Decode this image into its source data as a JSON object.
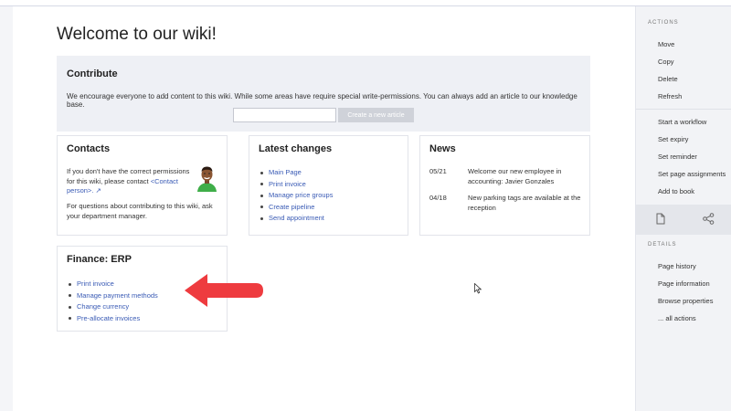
{
  "page": {
    "title": "Welcome to our wiki!"
  },
  "contribute": {
    "heading": "Contribute",
    "text": "We encourage everyone to add content to this wiki. While some areas have require special write-permissions. You can always add an article to our knowledge base.",
    "input_value": "",
    "button_label": "Create a new article"
  },
  "contacts": {
    "heading": "Contacts",
    "text1": "If you don't have the correct permissions for this wiki, please contact",
    "link": "<Contact person>.",
    "text2": "For questions about contributing to this wiki, ask your department manager."
  },
  "latest": {
    "heading": "Latest changes",
    "items": [
      "Main Page",
      "Print invoice",
      "Manage price groups",
      "Create pipeline",
      "Send appointment"
    ]
  },
  "news": {
    "heading": "News",
    "items": [
      {
        "date": "05/21",
        "text": "Welcome our new employee in accounting: Javier Gonzales"
      },
      {
        "date": "04/18",
        "text": "New parking tags are available at the reception"
      }
    ]
  },
  "finance": {
    "heading": "Finance: ERP",
    "items": [
      "Print invoice",
      "Manage payment methods",
      "Change currency",
      "Pre-allocate invoices"
    ]
  },
  "sidebar": {
    "actions_heading": "ACTIONS",
    "actions": [
      "Move",
      "Copy",
      "Delete",
      "Refresh"
    ],
    "workflow": [
      "Start a workflow",
      "Set expiry",
      "Set reminder",
      "Set page assignments",
      "Add to book"
    ],
    "icons": [
      "page-icon",
      "share-icon"
    ],
    "details_heading": "DETAILS",
    "details": [
      "Page history",
      "Page information",
      "Browse properties",
      "... all actions"
    ]
  },
  "colors": {
    "link": "#3a5bb5",
    "arrow": "#ee3b3f",
    "sidebar_bg": "#f2f3f6",
    "contribute_bg": "#eef0f5"
  }
}
